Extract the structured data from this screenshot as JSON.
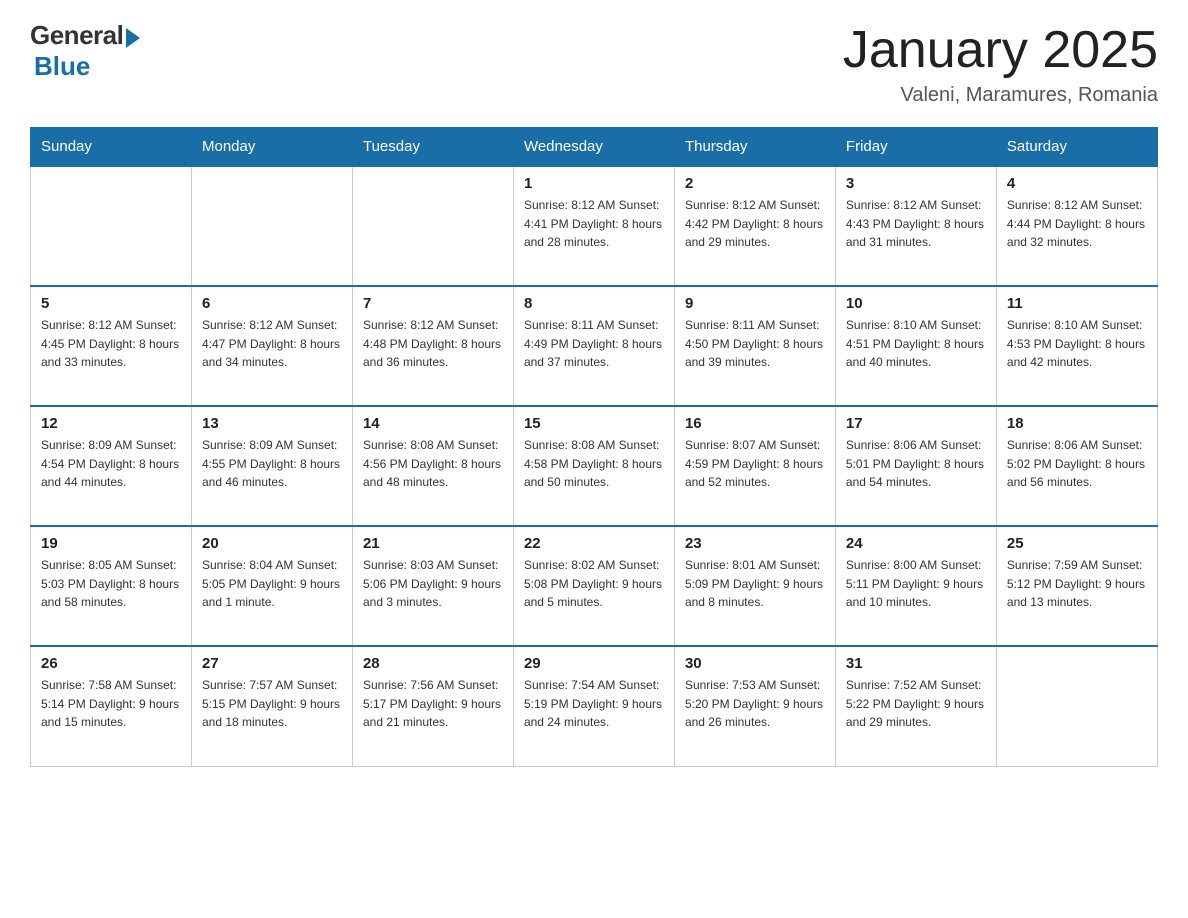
{
  "header": {
    "logo_general": "General",
    "logo_blue": "Blue",
    "title": "January 2025",
    "subtitle": "Valeni, Maramures, Romania"
  },
  "days_of_week": [
    "Sunday",
    "Monday",
    "Tuesday",
    "Wednesday",
    "Thursday",
    "Friday",
    "Saturday"
  ],
  "weeks": [
    [
      {
        "day": "",
        "info": ""
      },
      {
        "day": "",
        "info": ""
      },
      {
        "day": "",
        "info": ""
      },
      {
        "day": "1",
        "info": "Sunrise: 8:12 AM\nSunset: 4:41 PM\nDaylight: 8 hours\nand 28 minutes."
      },
      {
        "day": "2",
        "info": "Sunrise: 8:12 AM\nSunset: 4:42 PM\nDaylight: 8 hours\nand 29 minutes."
      },
      {
        "day": "3",
        "info": "Sunrise: 8:12 AM\nSunset: 4:43 PM\nDaylight: 8 hours\nand 31 minutes."
      },
      {
        "day": "4",
        "info": "Sunrise: 8:12 AM\nSunset: 4:44 PM\nDaylight: 8 hours\nand 32 minutes."
      }
    ],
    [
      {
        "day": "5",
        "info": "Sunrise: 8:12 AM\nSunset: 4:45 PM\nDaylight: 8 hours\nand 33 minutes."
      },
      {
        "day": "6",
        "info": "Sunrise: 8:12 AM\nSunset: 4:47 PM\nDaylight: 8 hours\nand 34 minutes."
      },
      {
        "day": "7",
        "info": "Sunrise: 8:12 AM\nSunset: 4:48 PM\nDaylight: 8 hours\nand 36 minutes."
      },
      {
        "day": "8",
        "info": "Sunrise: 8:11 AM\nSunset: 4:49 PM\nDaylight: 8 hours\nand 37 minutes."
      },
      {
        "day": "9",
        "info": "Sunrise: 8:11 AM\nSunset: 4:50 PM\nDaylight: 8 hours\nand 39 minutes."
      },
      {
        "day": "10",
        "info": "Sunrise: 8:10 AM\nSunset: 4:51 PM\nDaylight: 8 hours\nand 40 minutes."
      },
      {
        "day": "11",
        "info": "Sunrise: 8:10 AM\nSunset: 4:53 PM\nDaylight: 8 hours\nand 42 minutes."
      }
    ],
    [
      {
        "day": "12",
        "info": "Sunrise: 8:09 AM\nSunset: 4:54 PM\nDaylight: 8 hours\nand 44 minutes."
      },
      {
        "day": "13",
        "info": "Sunrise: 8:09 AM\nSunset: 4:55 PM\nDaylight: 8 hours\nand 46 minutes."
      },
      {
        "day": "14",
        "info": "Sunrise: 8:08 AM\nSunset: 4:56 PM\nDaylight: 8 hours\nand 48 minutes."
      },
      {
        "day": "15",
        "info": "Sunrise: 8:08 AM\nSunset: 4:58 PM\nDaylight: 8 hours\nand 50 minutes."
      },
      {
        "day": "16",
        "info": "Sunrise: 8:07 AM\nSunset: 4:59 PM\nDaylight: 8 hours\nand 52 minutes."
      },
      {
        "day": "17",
        "info": "Sunrise: 8:06 AM\nSunset: 5:01 PM\nDaylight: 8 hours\nand 54 minutes."
      },
      {
        "day": "18",
        "info": "Sunrise: 8:06 AM\nSunset: 5:02 PM\nDaylight: 8 hours\nand 56 minutes."
      }
    ],
    [
      {
        "day": "19",
        "info": "Sunrise: 8:05 AM\nSunset: 5:03 PM\nDaylight: 8 hours\nand 58 minutes."
      },
      {
        "day": "20",
        "info": "Sunrise: 8:04 AM\nSunset: 5:05 PM\nDaylight: 9 hours\nand 1 minute."
      },
      {
        "day": "21",
        "info": "Sunrise: 8:03 AM\nSunset: 5:06 PM\nDaylight: 9 hours\nand 3 minutes."
      },
      {
        "day": "22",
        "info": "Sunrise: 8:02 AM\nSunset: 5:08 PM\nDaylight: 9 hours\nand 5 minutes."
      },
      {
        "day": "23",
        "info": "Sunrise: 8:01 AM\nSunset: 5:09 PM\nDaylight: 9 hours\nand 8 minutes."
      },
      {
        "day": "24",
        "info": "Sunrise: 8:00 AM\nSunset: 5:11 PM\nDaylight: 9 hours\nand 10 minutes."
      },
      {
        "day": "25",
        "info": "Sunrise: 7:59 AM\nSunset: 5:12 PM\nDaylight: 9 hours\nand 13 minutes."
      }
    ],
    [
      {
        "day": "26",
        "info": "Sunrise: 7:58 AM\nSunset: 5:14 PM\nDaylight: 9 hours\nand 15 minutes."
      },
      {
        "day": "27",
        "info": "Sunrise: 7:57 AM\nSunset: 5:15 PM\nDaylight: 9 hours\nand 18 minutes."
      },
      {
        "day": "28",
        "info": "Sunrise: 7:56 AM\nSunset: 5:17 PM\nDaylight: 9 hours\nand 21 minutes."
      },
      {
        "day": "29",
        "info": "Sunrise: 7:54 AM\nSunset: 5:19 PM\nDaylight: 9 hours\nand 24 minutes."
      },
      {
        "day": "30",
        "info": "Sunrise: 7:53 AM\nSunset: 5:20 PM\nDaylight: 9 hours\nand 26 minutes."
      },
      {
        "day": "31",
        "info": "Sunrise: 7:52 AM\nSunset: 5:22 PM\nDaylight: 9 hours\nand 29 minutes."
      },
      {
        "day": "",
        "info": ""
      }
    ]
  ]
}
